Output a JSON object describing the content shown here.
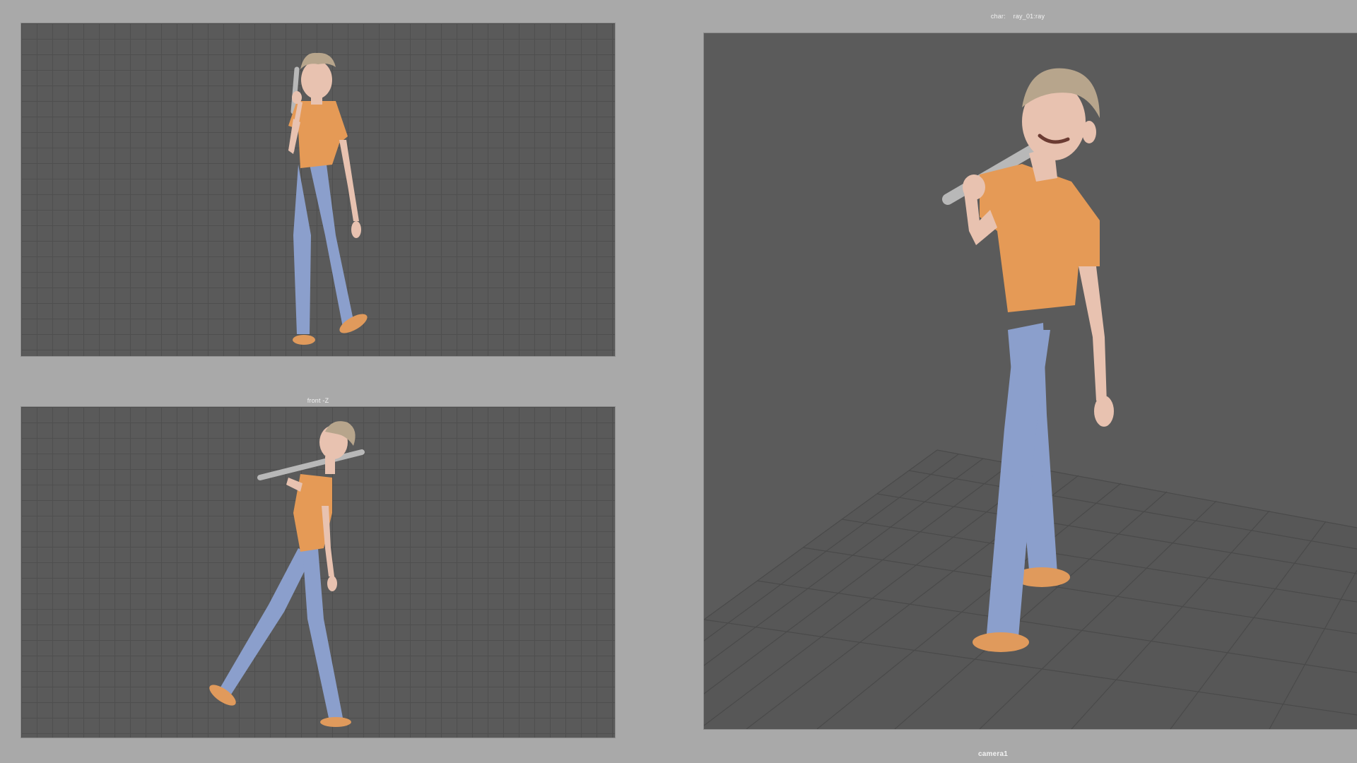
{
  "viewports": {
    "front": {},
    "side": {
      "label": "front -Z"
    },
    "camera": {
      "label": "camera1",
      "header_key": "char:",
      "header_value": "ray_01:ray"
    }
  },
  "character": {
    "shirt_color": "#e59a56",
    "pants_color": "#8b9fcc",
    "skin_color": "#e8c2b0",
    "hair_color": "#b7a58c",
    "shoe_color": "#e09a5c",
    "prop": "metal-pipe"
  },
  "colors": {
    "app_background": "#a9a9a9",
    "viewport_background": "#5a5a5a",
    "grid_line": "#4f4f4f"
  }
}
